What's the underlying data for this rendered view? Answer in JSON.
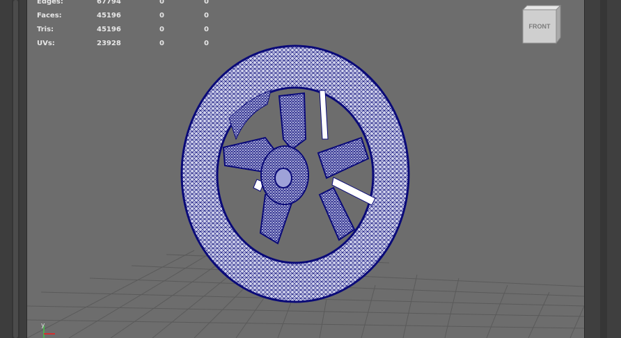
{
  "hud": {
    "rows": [
      {
        "label": "Edges:",
        "v1": "67794",
        "v2": "0",
        "v3": "0"
      },
      {
        "label": "Faces:",
        "v1": "45196",
        "v2": "0",
        "v3": "0"
      },
      {
        "label": "Tris:",
        "v1": "45196",
        "v2": "0",
        "v3": "0"
      },
      {
        "label": "UVs:",
        "v1": "23928",
        "v2": "0",
        "v3": "0"
      }
    ]
  },
  "viewcube": {
    "face_label": "FRONT"
  },
  "axis": {
    "y_label": "y"
  },
  "colors": {
    "viewport_bg": "#6d6d6d",
    "grid": "#5a5a5a",
    "wire": "#0a0a78",
    "wire_fill": "#c8cae6"
  }
}
